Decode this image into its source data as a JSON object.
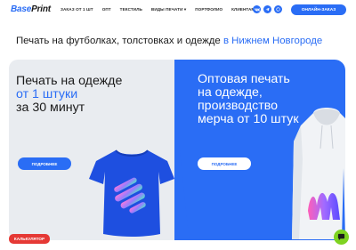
{
  "header": {
    "logo_part1": "Base",
    "logo_part2": "Print",
    "nav": [
      "ЗАКАЗ ОТ 1 ШТ",
      "ОПТ",
      "ТЕКСТИЛЬ",
      "ВИДЫ ПЕЧАТИ ▾",
      "ПОРТФОЛИО",
      "КЛИЕНТАМ ▾"
    ],
    "socials": [
      "vk-icon",
      "telegram-icon",
      "whatsapp-icon"
    ],
    "order_button": "ОНЛАЙН-ЗАКАЗ"
  },
  "headline": {
    "text": "Печать на футболках, толстовках и одежде ",
    "city": "в Нижнем Новгороде"
  },
  "left_panel": {
    "line1": "Печать на одежде",
    "line2": "от 1 штуки",
    "line3": "за 30 минут",
    "button": "ПОДРОБНЕЕ"
  },
  "right_panel": {
    "line1": "Оптовая печать",
    "line2": "на одежде,",
    "line3": "производство",
    "line4": "мерча от 10 штук",
    "button": "ПОДРОБНЕЕ"
  },
  "calculator_button": "КАЛЬКУЛЯТОР",
  "colors": {
    "accent": "#2a6df5",
    "calculator": "#e53935",
    "chat": "#7ed321"
  }
}
